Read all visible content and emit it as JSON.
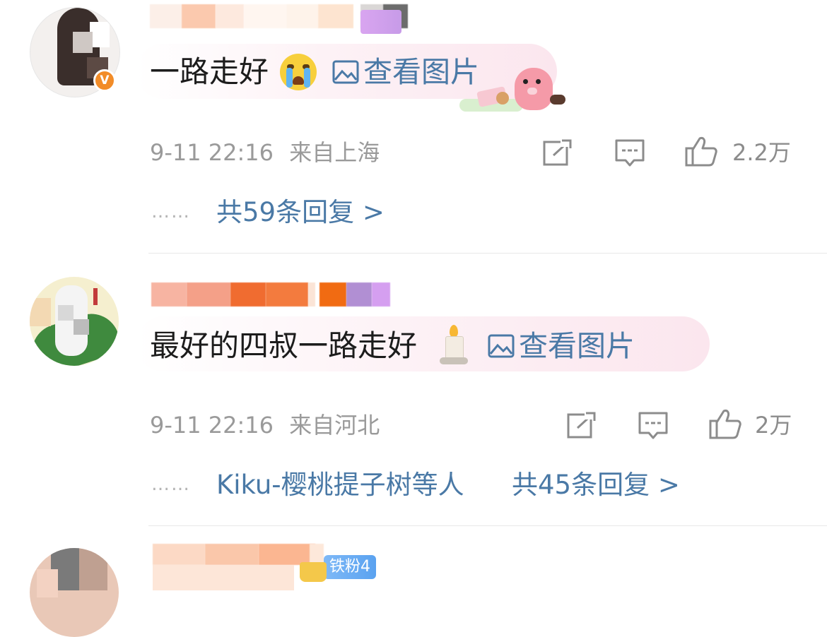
{
  "comments": [
    {
      "text": "一路走好",
      "emoji": "crying-face",
      "view_image": "查看图片",
      "time": "9-11 22:16",
      "location": "来自上海",
      "likes": "2.2万",
      "replies": "共59条回复 >",
      "reply_users": ""
    },
    {
      "text": "最好的四叔一路走好",
      "emoji": "candle",
      "view_image": "查看图片",
      "time": "9-11 22:16",
      "location": "来自河北",
      "likes": "2万",
      "replies": "共45条回复 >",
      "reply_users": "Kiku-樱桃提子树等人"
    },
    {
      "badge": "铁粉4"
    }
  ],
  "dots": "……",
  "colors": {
    "link": "#4a79a6",
    "meta": "#9a9a9a",
    "verified": "#f28c28"
  }
}
